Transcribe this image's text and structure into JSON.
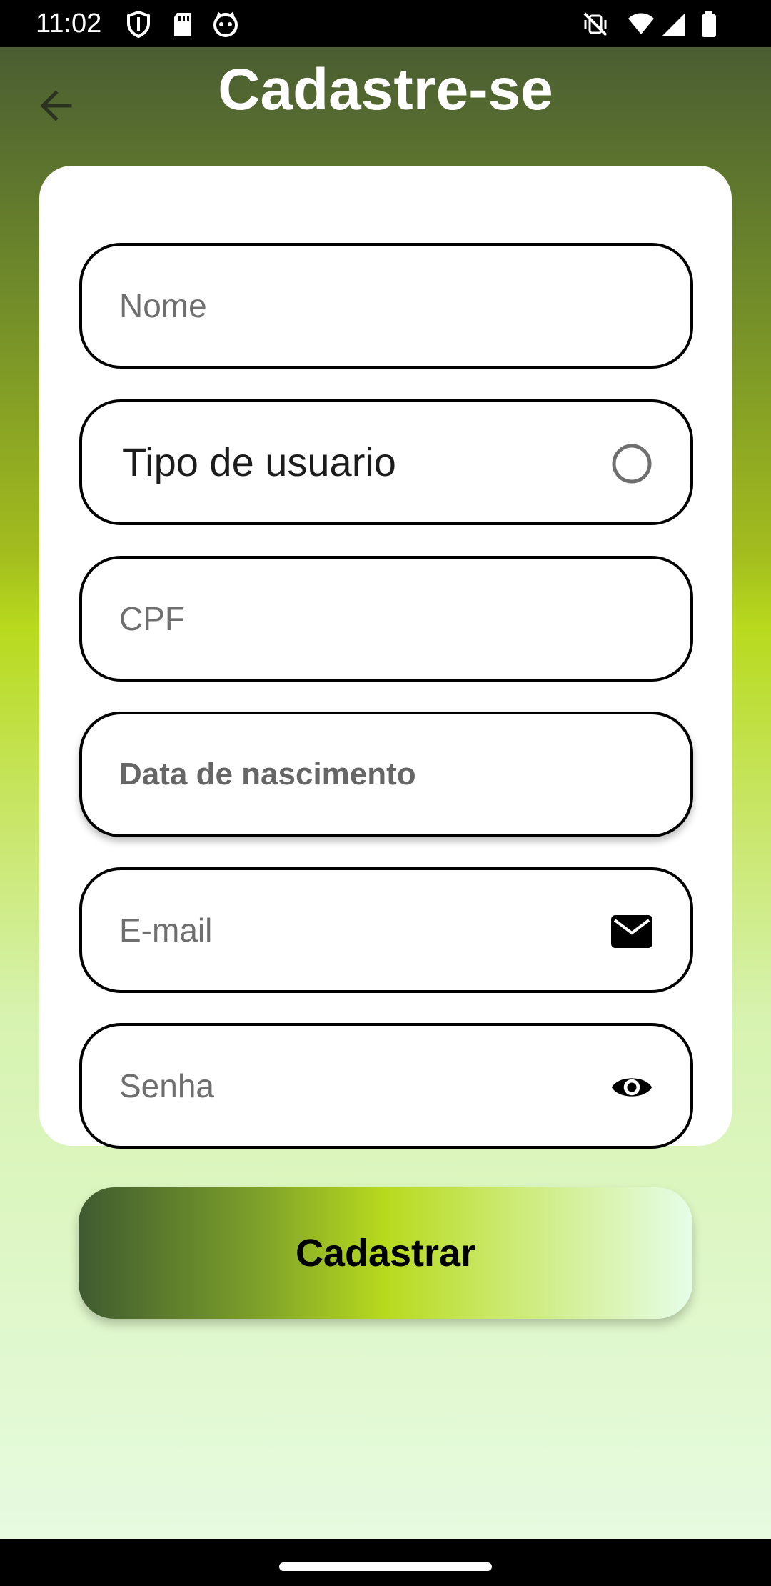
{
  "status_bar": {
    "time": "11:02",
    "left_icons": [
      "shield-icon",
      "sd-card-icon",
      "cat-face-icon"
    ],
    "right_icons": [
      "mute-vibrate-icon",
      "wifi-icon",
      "signal-icon",
      "battery-icon"
    ]
  },
  "header": {
    "back_icon": "arrow-left-icon",
    "title": "Cadastre-se"
  },
  "form": {
    "name": {
      "placeholder": "Nome"
    },
    "user_type": {
      "label": "Tipo de usuario",
      "trailing_icon": "radio-circle-icon"
    },
    "cpf": {
      "placeholder": "CPF"
    },
    "birth_date": {
      "placeholder": "Data de nascimento"
    },
    "email": {
      "placeholder": "E-mail",
      "trailing_icon": "mail-icon"
    },
    "password": {
      "placeholder": "Senha",
      "trailing_icon": "eye-icon"
    }
  },
  "actions": {
    "submit_label": "Cadastrar"
  },
  "colors": {
    "gradient_top": "#4a5d32",
    "gradient_mid": "#b8da1e",
    "gradient_bottom": "#e6fbe0",
    "card": "#ffffff",
    "border": "#000000"
  }
}
